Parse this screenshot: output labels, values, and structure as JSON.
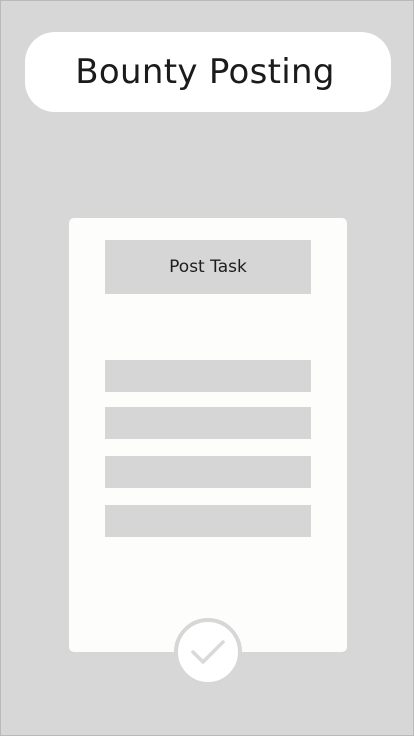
{
  "header": {
    "title": "Bounty Posting"
  },
  "form": {
    "post_task_label": "Post Task",
    "fields": [
      {
        "value": ""
      },
      {
        "value": ""
      },
      {
        "value": ""
      },
      {
        "value": ""
      }
    ]
  },
  "confirm": {
    "icon": "checkmark-icon"
  },
  "colors": {
    "background": "#d7d7d7",
    "card": "#fdfdfb",
    "field": "#d6d6d6",
    "check": "#d9d9d9"
  }
}
